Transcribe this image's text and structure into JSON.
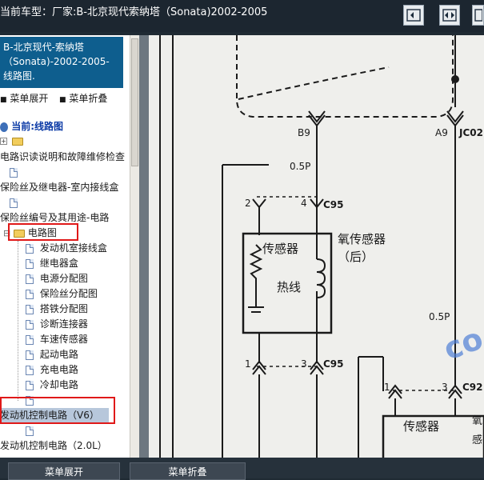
{
  "header": {
    "title": "当前车型：厂家:B-北京现代索纳塔（Sonata)2002-2005",
    "buttons": [
      {
        "name": "collapse-left-button",
        "icon": "panel-left-icon"
      },
      {
        "name": "expand-both-button",
        "icon": "panel-both-icon"
      },
      {
        "name": "collapse-right-button",
        "icon": "panel-right-icon"
      }
    ]
  },
  "sidebar": {
    "heading": "B-北京现代-索纳塔\n（Sonata)-2002-2005-\n线路图.",
    "expand_all": "菜单展开",
    "collapse_all": "菜单折叠",
    "current": "当前:线路图",
    "items": [
      {
        "label": "电路识读说明和故障维修检查"
      },
      {
        "label": "保险丝及继电器-室内接线盒"
      },
      {
        "label": "保险丝编号及其用途-电路"
      },
      {
        "label": "电路图"
      },
      {
        "label": "发动机室接线盒"
      },
      {
        "label": "继电器盒"
      },
      {
        "label": "电源分配图"
      },
      {
        "label": "保险丝分配图"
      },
      {
        "label": "搭铁分配图"
      },
      {
        "label": "诊断连接器"
      },
      {
        "label": "车速传感器"
      },
      {
        "label": "起动电路"
      },
      {
        "label": "充电电路"
      },
      {
        "label": "冷却电路"
      },
      {
        "label": "发动机控制电路（V6）"
      },
      {
        "label": "发动机控制电路（2.0L）"
      }
    ]
  },
  "footer": {
    "expand_all": "菜单展开",
    "collapse_all": "菜单折叠"
  },
  "diagram": {
    "labels": {
      "b9": "B9",
      "a9": "A9",
      "jc02": "JC02",
      "wire1": "0.5P",
      "wire2": "0.5P",
      "c95_top": "C95",
      "c95_bottom": "C95",
      "c92": "C92",
      "pin2": "2",
      "pin4": "4",
      "pin1": "1",
      "pin3": "3",
      "pin1b": "1",
      "pin3b": "3",
      "sensor": "传感器",
      "heater": "热线",
      "o2_title": "氧传感器",
      "o2_sub": "（后）",
      "sensor2": "传感器",
      "sensor2_side": "氧",
      "sensor2_side2": "感",
      "watermark": "co"
    }
  },
  "colors": {
    "header_bg": "#1c2630",
    "sidebar_heading_bg": "#0e5e8e",
    "highlight_box": "#e01919",
    "diagram_ink": "#1a1a1a"
  }
}
